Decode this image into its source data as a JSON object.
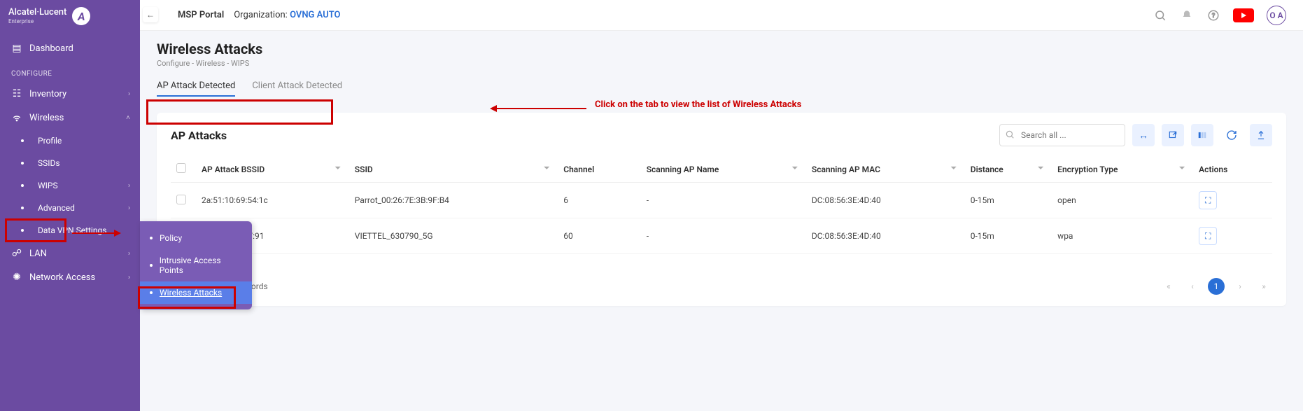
{
  "brand": {
    "name": "Alcatel·Lucent",
    "sub": "Enterprise",
    "badge": "A"
  },
  "topbar": {
    "portal": "MSP Portal",
    "org_label": "Organization:",
    "org_name": "OVNG AUTO",
    "avatar_initials": "O A"
  },
  "sidebar": {
    "items": [
      {
        "label": "Dashboard"
      },
      {
        "heading": "CONFIGURE"
      },
      {
        "label": "Inventory",
        "chev": "›"
      },
      {
        "label": "Wireless",
        "chev": "˄",
        "expanded": true
      },
      {
        "label": "Profile",
        "sub": true
      },
      {
        "label": "SSIDs",
        "sub": true
      },
      {
        "label": "WIPS",
        "sub": true,
        "chev": "›"
      },
      {
        "label": "Advanced",
        "sub": true,
        "chev": "›"
      },
      {
        "label": "Data VPN Settings",
        "sub": true
      },
      {
        "label": "LAN",
        "chev": "›"
      },
      {
        "label": "Network Access",
        "chev": "›"
      }
    ]
  },
  "flyout": {
    "items": [
      {
        "label": "Policy"
      },
      {
        "label": "Intrusive Access Points"
      },
      {
        "label": "Wireless Attacks",
        "active": true
      }
    ]
  },
  "page": {
    "title": "Wireless Attacks",
    "breadcrumb": "Configure  -  Wireless  -  WIPS",
    "tabs": [
      {
        "label": "AP Attack Detected",
        "active": true
      },
      {
        "label": "Client Attack Detected"
      }
    ]
  },
  "annotation": {
    "text": "Click on the tab to view the list of Wireless Attacks"
  },
  "card": {
    "title": "AP Attacks",
    "search_placeholder": "Search all ...",
    "columns": [
      "AP Attack BSSID",
      "SSID",
      "Channel",
      "Scanning AP Name",
      "Scanning AP MAC",
      "Distance",
      "Encryption Type",
      "Actions"
    ],
    "rows": [
      {
        "bssid": "2a:51:10:69:54:1c",
        "ssid": "Parrot_00:26:7E:3B:9F:B4",
        "channel": "6",
        "ap_name": "-",
        "ap_mac": "DC:08:56:3E:4D:40",
        "distance": "0-15m",
        "enc": "open"
      },
      {
        "bssid": "c6:eb:ff:73:07:91",
        "ssid": "VIETTEL_630790_5G",
        "channel": "60",
        "ap_name": "-",
        "ap_mac": "DC:08:56:3E:4D:40",
        "distance": "0-15m",
        "enc": "wpa"
      }
    ],
    "footer_text": "Showing 1 - 2 of 2 records",
    "current_page": "1"
  }
}
